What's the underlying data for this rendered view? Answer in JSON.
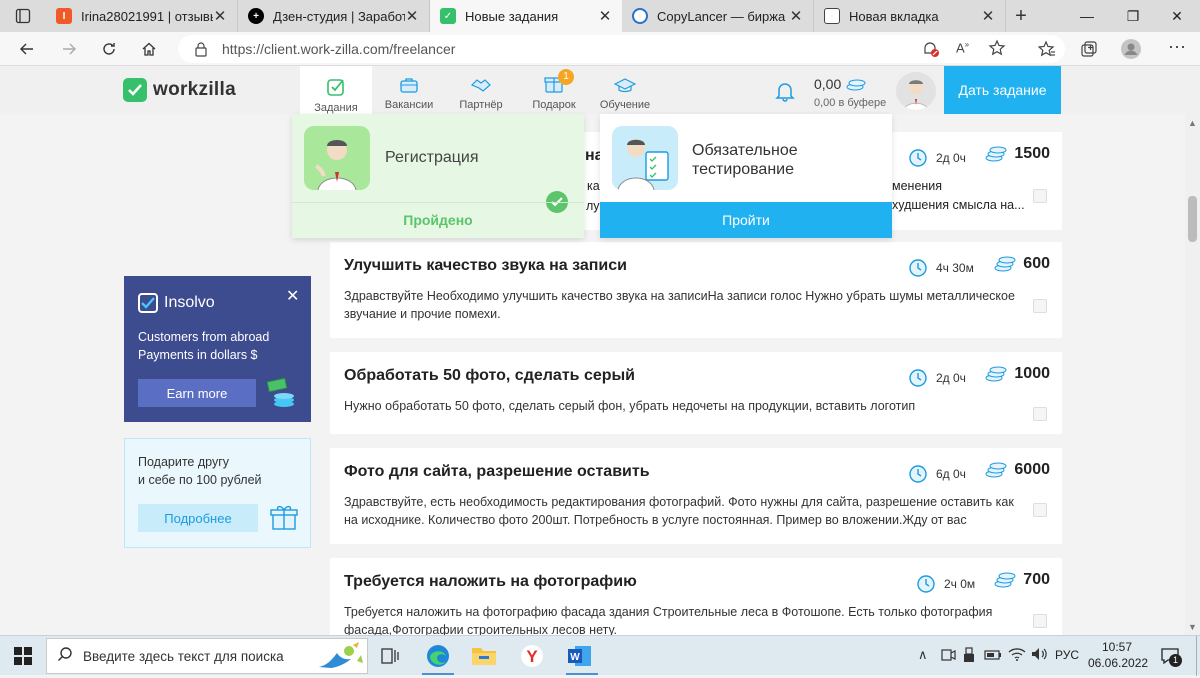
{
  "browser": {
    "tabs": [
      {
        "title": "Irina28021991 | отзывы",
        "fav_color": "#f05a28"
      },
      {
        "title": "Дзен-студия | Заработок",
        "fav_color": "#000000"
      },
      {
        "title": "Новые задания",
        "fav_color": "#36c06b"
      },
      {
        "title": "CopyLancer — биржа ко",
        "fav_color": "#2a6fd6"
      },
      {
        "title": "Новая вкладка",
        "fav_color": "#444444"
      }
    ],
    "url": "https://client.work-zilla.com/freelancer"
  },
  "header": {
    "logo": "workzilla",
    "nav": [
      {
        "label": "Задания"
      },
      {
        "label": "Вакансии"
      },
      {
        "label": "Партнёр"
      },
      {
        "label": "Подарок",
        "badge": "1"
      },
      {
        "label": "Обучение"
      }
    ],
    "balance": "0,00",
    "buffer": "0,00 в буфере",
    "cta": "Дать задание"
  },
  "popup": {
    "step1": {
      "title": "Регистрация",
      "status": "Пройдено"
    },
    "step2": {
      "title": "Обязательное тестирование",
      "button": "Пройти"
    }
  },
  "card0_tail": {
    "title_tail": "на",
    "d1": "ка",
    "d2": "лу",
    "d3": "менения",
    "d4": "худшения смысла на...",
    "time": "2д 0ч",
    "price": "1500"
  },
  "tasks": [
    {
      "title": "Улучшить качество звука на записи",
      "desc": "Здравствуйте Необходимо улучшить качество звука на записиНа записи голос Нужно убрать шумы металлическое звучание и прочие помехи.",
      "time": "4ч 30м",
      "price": "600"
    },
    {
      "title": "Обработать 50 фото, сделать серый",
      "desc": "Нужно обработать 50 фото, сделать серый фон, убрать недочеты на продукции, вставить логотип",
      "time": "2д 0ч",
      "price": "1000"
    },
    {
      "title": "Фото для сайта, разрешение оставить",
      "desc": "Здравствуйте, есть необходимость редактирования фотографий. Фото нужны для сайта, разрешение оставить как на исходнике. Количество фото 200шт. Потребность в услуге постоянная. Пример во вложении.Жду от вас предложен...",
      "time": "6д 0ч",
      "price": "6000"
    },
    {
      "title": "Требуется наложить на фотографию",
      "desc": "Требуется наложить на фотографию фасада здания Строительные леса в Фотошопе. Есть только фотография фасада,Фотографии строительных лесов нету.",
      "time": "2ч 0м",
      "price": "700"
    }
  ],
  "promo_insolvo": {
    "brand": "Insolvo",
    "line1": "Customers from abroad",
    "line2": "Payments in dollars $",
    "button": "Earn more"
  },
  "promo_gift": {
    "line1": "Подарите другу",
    "line2": "и себе по 100 рублей",
    "button": "Подробнее"
  },
  "taskbar": {
    "search_placeholder": "Введите здесь текст для поиска",
    "lang": "РУС",
    "time": "10:57",
    "date": "06.06.2022",
    "notif": "1"
  }
}
